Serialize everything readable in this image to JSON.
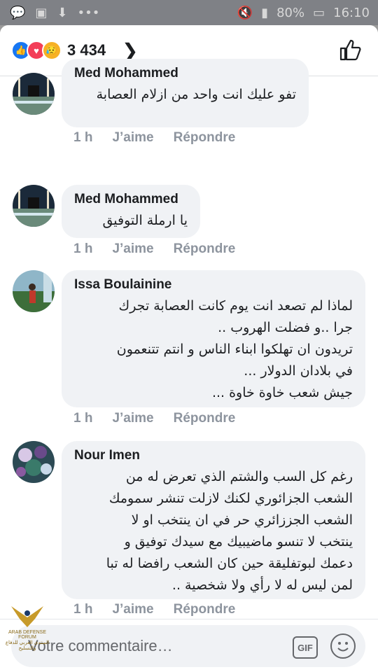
{
  "status": {
    "battery": "80%",
    "time": "16:10"
  },
  "header": {
    "reaction_count": "3 434"
  },
  "comments": [
    {
      "author": "Med Mohammed",
      "text": "تفو عليك انت واحد من ازلام العصابة",
      "time": "1 h",
      "like": "J’aime",
      "reply": "Répondre"
    },
    {
      "author": "Med Mohammed",
      "text": "يا ارملة التوفيق",
      "time": "1 h",
      "like": "J’aime",
      "reply": "Répondre"
    },
    {
      "author": "Issa Boulainine",
      "text": "لماذا لم تصعد انت يوم كانت العصابة تجرك\nجرا ..و فضلت الهروب ..\nتريدون ان تهلكوا ابناء الناس و انتم تتنعمون\nفي بلادان الدولار ...\nجيش شعب خاوة خاوة ...",
      "time": "1 h",
      "like": "J’aime",
      "reply": "Répondre"
    },
    {
      "author": "Nour Imen",
      "text": "رغم كل السب والشتم الذي تعرض له من\nالشعب الجزائوري لكنك لازلت تنشر سمومك\nالشعب الجززائري حر في ان ينتخب او لا\nينتخب لا تنسو ماضيبيك مع سيدك توفيق و\nدعمك لبوتفليقة حين كان الشعب رافضا له تبا\nلمن ليس له لا رأي ولا شخصية ..",
      "time": "1 h",
      "like": "J’aime",
      "reply": "Répondre"
    }
  ],
  "composer": {
    "placeholder": "Votre commentaire…",
    "gif_label": "GIF"
  },
  "watermark": {
    "line1": "ARAB DEFENSE FORUM",
    "line2": "المنتدى العربي للدفاع والتسليح"
  }
}
